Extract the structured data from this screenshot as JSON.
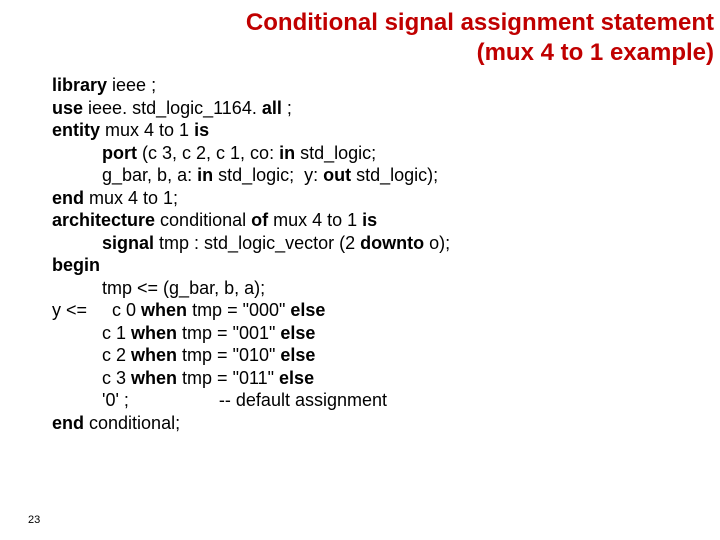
{
  "title_line1": "Conditional signal assignment statement",
  "title_line2": "(mux 4 to 1 example)",
  "page_number": "23",
  "code": {
    "l1": {
      "k1": "library",
      "t1": " ieee ;"
    },
    "l2": {
      "k1": "use",
      "t1": " ieee. std_logic_1164. ",
      "k2": "all",
      "t2": " ;"
    },
    "l3": {
      "k1": "entity",
      "t1": " mux 4 to 1 ",
      "k2": "is"
    },
    "l4": {
      "k1": "port",
      "t1": " (c 3, c 2, c 1, co: ",
      "k2": "in",
      "t2": " std_logic;"
    },
    "l5": {
      "t1": "g_bar, b, a: ",
      "k1": "in",
      "t2": " std_logic;  y: ",
      "k2": "out",
      "t3": " std_logic);"
    },
    "l6": {
      "k1": "end",
      "t1": " mux 4 to 1;"
    },
    "l7": {
      "k1": "architecture",
      "t1": " conditional ",
      "k2": "of",
      "t2": " mux 4 to 1 ",
      "k3": "is"
    },
    "l8": {
      "k1": "signal",
      "t1": " tmp : std_logic_vector (2 ",
      "k2": "downto",
      "t2": " o);"
    },
    "l9": {
      "k1": "begin"
    },
    "l10": {
      "t1": "tmp <= (g_bar, b, a);"
    },
    "l11": {
      "t1": "y <=     c 0 ",
      "k1": "when",
      "t2": " tmp = \"000\" ",
      "k2": "else"
    },
    "l12": {
      "t1": "c 1 ",
      "k1": "when",
      "t2": " tmp = \"001\" ",
      "k2": "else"
    },
    "l13": {
      "t1": "c 2 ",
      "k1": "when",
      "t2": " tmp = \"010\" ",
      "k2": "else"
    },
    "l14": {
      "t1": "c 3 ",
      "k1": "when",
      "t2": " tmp = \"011\" ",
      "k2": "else"
    },
    "l15": {
      "t1": "'0' ;                  -- default assignment"
    },
    "l16": {
      "k1": "end",
      "t1": " conditional;"
    }
  }
}
